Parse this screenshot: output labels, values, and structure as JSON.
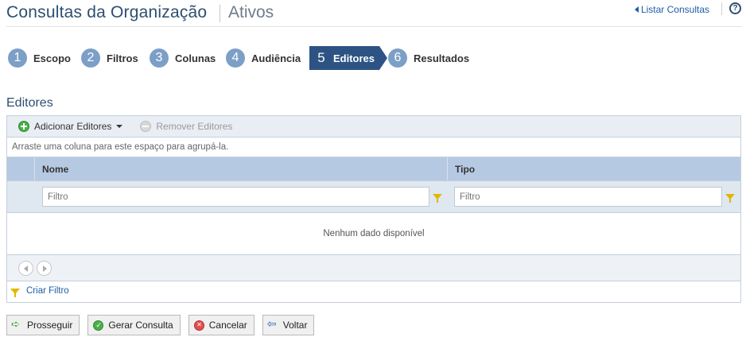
{
  "header": {
    "title": "Consultas da Organização",
    "subtitle": "Ativos",
    "list_link": "Listar Consultas",
    "help_label": "?"
  },
  "steps": [
    {
      "num": "1",
      "label": "Escopo"
    },
    {
      "num": "2",
      "label": "Filtros"
    },
    {
      "num": "3",
      "label": "Colunas"
    },
    {
      "num": "4",
      "label": "Audiência"
    },
    {
      "num": "5",
      "label": "Editores"
    },
    {
      "num": "6",
      "label": "Resultados"
    }
  ],
  "section_title": "Editores",
  "grid": {
    "toolbar": {
      "add_label": "Adicionar Editores",
      "remove_label": "Remover Editores"
    },
    "group_hint": "Arraste uma coluna para este espaço para agrupá-la.",
    "columns": [
      "Nome",
      "Tipo"
    ],
    "filter_placeholder": "Filtro",
    "empty_message": "Nenhum dado disponível",
    "create_filter": "Criar Filtro"
  },
  "actions": {
    "proceed": "Prosseguir",
    "generate": "Gerar Consulta",
    "cancel": "Cancelar",
    "back": "Voltar"
  },
  "colors": {
    "title": "#2d4f70",
    "step_active": "#2d5384",
    "step_circle": "#7c9fc7",
    "column_header": "#b6c9e3"
  }
}
